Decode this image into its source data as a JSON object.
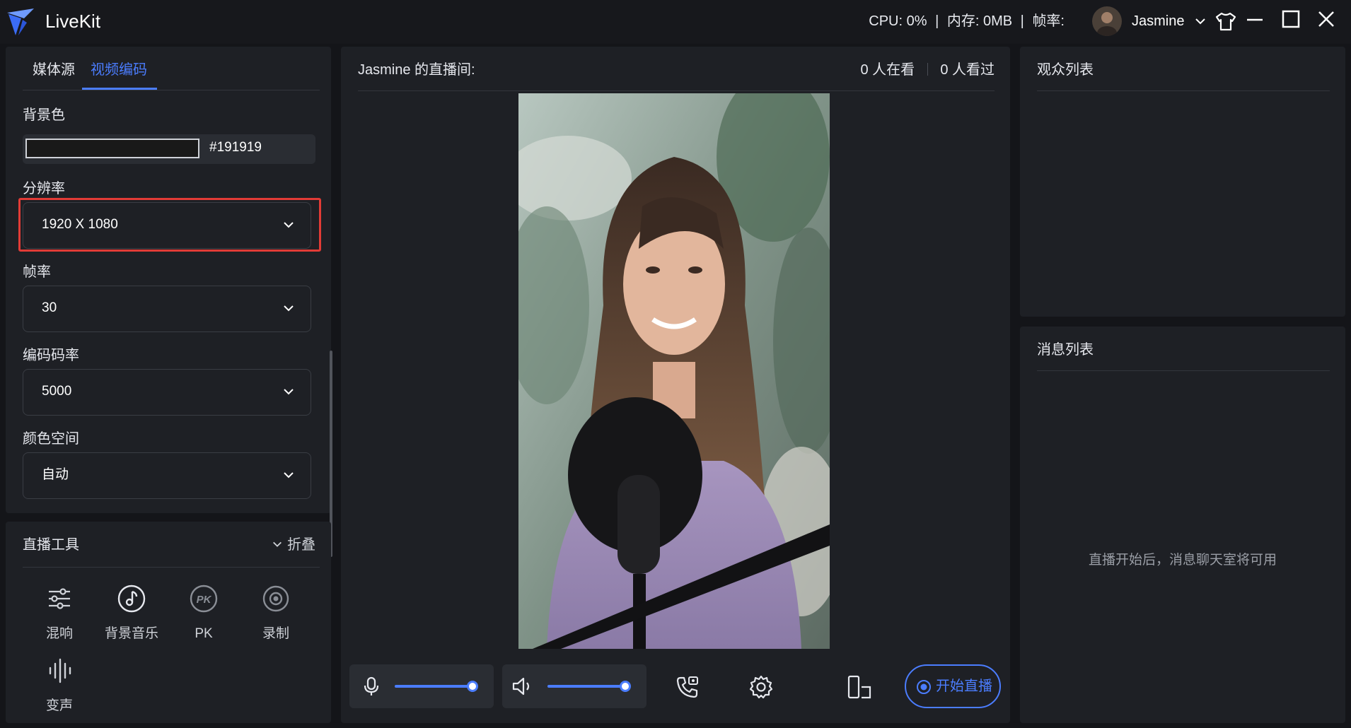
{
  "app": {
    "title": "LiveKit"
  },
  "header": {
    "cpu_label": "CPU:",
    "cpu_value": "0%",
    "mem_label": "内存:",
    "mem_value": "0MB",
    "fps_label": "帧率:",
    "user_name": "Jasmine"
  },
  "left": {
    "tabs": [
      {
        "label": "媒体源"
      },
      {
        "label": "视频编码"
      }
    ],
    "active_tab": "视频编码",
    "background": {
      "label": "背景色",
      "value": "#191919"
    },
    "resolution": {
      "label": "分辨率",
      "value": "1920 X 1080"
    },
    "framerate": {
      "label": "帧率",
      "value": "30"
    },
    "bitrate": {
      "label": "编码码率",
      "value": "5000"
    },
    "colorspace": {
      "label": "颜色空间",
      "value": "自动"
    }
  },
  "tools": {
    "title": "直播工具",
    "collapse_label": "折叠",
    "items": [
      {
        "label": "混响",
        "icon": "mixer-icon"
      },
      {
        "label": "背景音乐",
        "icon": "music-note-icon"
      },
      {
        "label": "PK",
        "icon": "pk-icon"
      },
      {
        "label": "录制",
        "icon": "record-icon"
      },
      {
        "label": "变声",
        "icon": "voice-wave-icon"
      }
    ]
  },
  "center": {
    "room_title": "Jasmine 的直播间:",
    "watching": "0 人在看",
    "watched": "0 人看过",
    "start_button": "开始直播",
    "mic_level": 0.95,
    "speaker_level": 0.95
  },
  "right": {
    "audience_title": "观众列表",
    "message_title": "消息列表",
    "message_placeholder": "直播开始后，消息聊天室将可用"
  },
  "colors": {
    "accent": "#4b7dff",
    "highlight": "#e23b36",
    "panel": "#1e2025",
    "background": "#141519"
  }
}
